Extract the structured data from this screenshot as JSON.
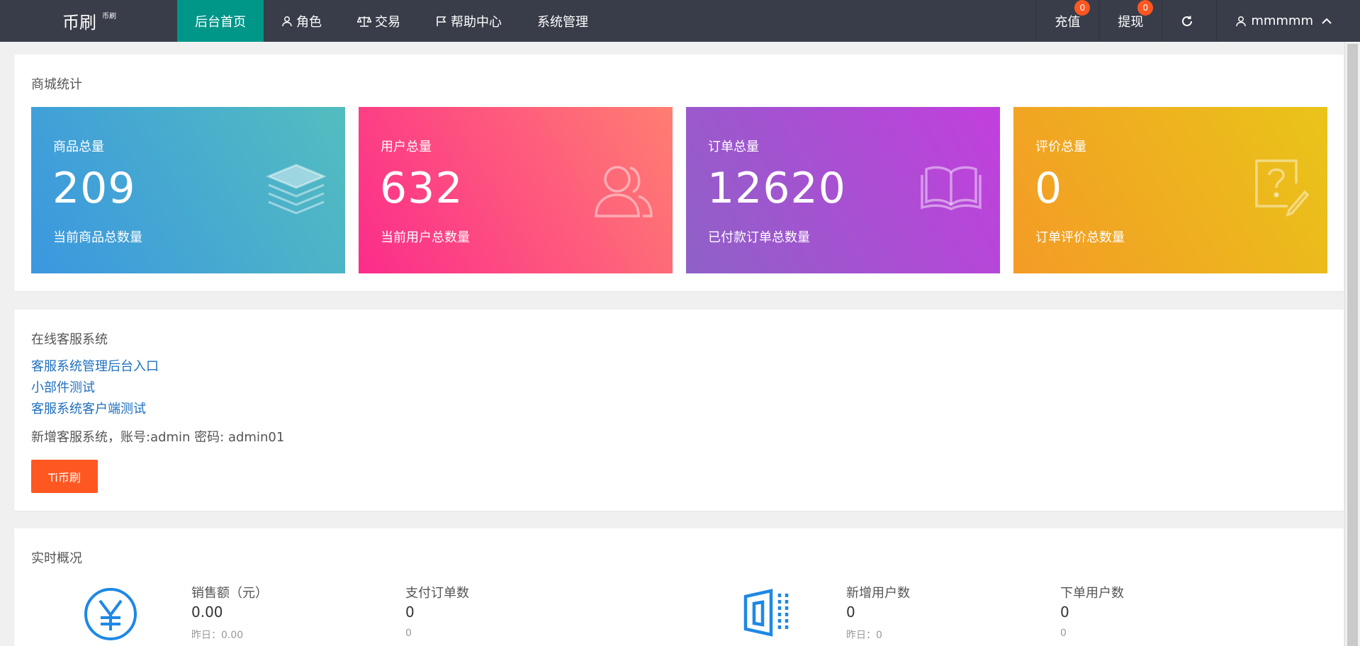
{
  "header": {
    "logo": "币刷",
    "logo_sup": "币刷",
    "nav": [
      {
        "label": "后台首页"
      },
      {
        "label": "角色"
      },
      {
        "label": "交易"
      },
      {
        "label": "帮助中心"
      },
      {
        "label": "系统管理"
      }
    ],
    "recharge": {
      "label": "充值",
      "badge": "0"
    },
    "withdraw": {
      "label": "提现",
      "badge": "0"
    },
    "user": {
      "name": "mmmmm"
    }
  },
  "stats": {
    "title": "商城统计",
    "cards": [
      {
        "label": "商品总量",
        "value": "209",
        "sub": "当前商品总数量",
        "icon": "layers-icon"
      },
      {
        "label": "用户总量",
        "value": "632",
        "sub": "当前用户总数量",
        "icon": "users-icon"
      },
      {
        "label": "订单总量",
        "value": "12620",
        "sub": "已付款订单总数量",
        "icon": "book-icon"
      },
      {
        "label": "评价总量",
        "value": "0",
        "sub": "订单评价总数量",
        "icon": "question-edit-icon"
      }
    ]
  },
  "support": {
    "title": "在线客服系统",
    "links": [
      "客服系统管理后台入口",
      "小部件测试",
      "客服系统客户端测试"
    ],
    "note": "新增客服系统，账号:admin 密码: admin01",
    "button": "Ti币刷"
  },
  "realtime": {
    "title": "实时概况",
    "items": [
      {
        "label": "销售额（元）",
        "value": "0.00",
        "sub": "昨日：0.00"
      },
      {
        "label": "支付订单数",
        "value": "0",
        "sub": "0"
      },
      {
        "label": "新增用户数",
        "value": "0",
        "sub": "昨日：0"
      },
      {
        "label": "下单用户数",
        "value": "0",
        "sub": "0"
      }
    ]
  },
  "colors": {
    "topbar": "#393d49",
    "active": "#009688",
    "badge": "#ff5722",
    "link": "#1e6fc0"
  }
}
